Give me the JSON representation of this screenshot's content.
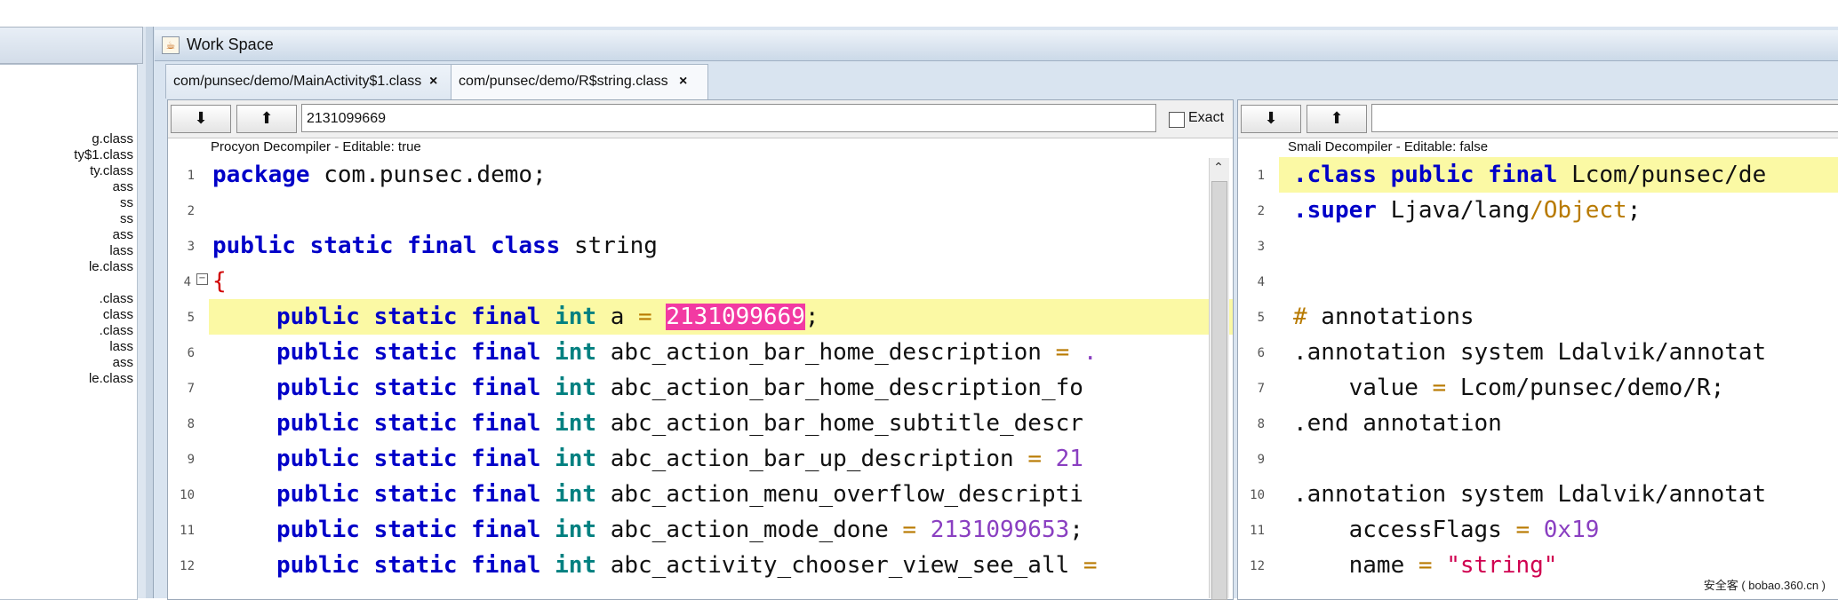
{
  "left_panel": {
    "tree_items": [
      "g.class",
      "ty$1.class",
      "ty.class",
      "ass",
      "ss",
      "ss",
      "ass",
      "lass",
      "le.class",
      "",
      ".class",
      "class",
      ".class",
      "lass",
      "ass",
      "le.class"
    ]
  },
  "workspace": {
    "title": "Work Space",
    "title_icon": "java-cup-icon"
  },
  "tabs": [
    {
      "label": "com/punsec/demo/MainActivity$1.class",
      "close": "×"
    },
    {
      "label": "com/punsec/demo/R$string.class",
      "close": "×"
    }
  ],
  "left_editor": {
    "download_button": "⬇",
    "upload_button": "⬆",
    "search_value": "2131099669",
    "exact_label": "Exact",
    "exact_checked": false,
    "decompiler_label": "Procyon Decompiler - Editable: true",
    "line_numbers": [
      "1",
      "2",
      "3",
      "4",
      "5",
      "6",
      "7",
      "8",
      "9",
      "10",
      "11",
      "12"
    ]
  },
  "right_editor": {
    "download_button": "⬇",
    "upload_button": "⬆",
    "search_value": "",
    "decompiler_label": "Smali Decompiler - Editable: false",
    "line_numbers": [
      "1",
      "2",
      "3",
      "4",
      "5",
      "6",
      "7",
      "8",
      "9",
      "10",
      "11",
      "12"
    ]
  },
  "code_left": {
    "l1_kw": "package",
    "l1_rest": " com.punsec.demo;",
    "l3_kw": "public static final class",
    "l3_rest": " string",
    "l4_brace": "{",
    "mods": "public static final",
    "type": "int",
    "eq": "=",
    "l5_name": " a ",
    "l5_value": "2131099669",
    "l5_end": ";",
    "l6_name": " abc_action_bar_home_description ",
    "l6_tail": ".",
    "l7_name": " abc_action_bar_home_description_fo",
    "l8_name": " abc_action_bar_home_subtitle_descr",
    "l9_name": " abc_action_bar_up_description ",
    "l9_tail": "21",
    "l10_name": " abc_action_menu_overflow_descripti",
    "l11_name": " abc_action_mode_done ",
    "l11_value": "2131099653",
    "l11_end": ";",
    "l12_name": " abc_activity_chooser_view_see_all ",
    "l12_tail": "="
  },
  "code_right": {
    "l1_dir": ".class public final",
    "l1_rest": " Lcom/punsec/de",
    "l2_dir": ".super",
    "l2_rest": " Ljava/lang",
    "l2_slash": "/",
    "l2_obj": "Object",
    "l2_end": ";",
    "l5_hash": "#",
    "l5_rest": " annotations",
    "l6": ".annotation system Ldalvik/annotat",
    "l7_key": "    value ",
    "l7_eq": "=",
    "l7_val": " Lcom/punsec/demo/R;",
    "l8": ".end annotation",
    "l10": ".annotation system Ldalvik/annotat",
    "l11_key": "    accessFlags ",
    "l11_eq": "=",
    "l11_val": "0x19",
    "l12_key": "    name ",
    "l12_eq": "=",
    "l12_val": "\"string\""
  },
  "scrollbar": {
    "up_arrow": "⌃"
  },
  "watermark": "安全客 ( bobao.360.cn )",
  "colors": {
    "keyword": "#0000c8",
    "type": "#008080",
    "number": "#8a3fc1",
    "highlight_line": "#fbf9a4",
    "search_match": "#f23aa2"
  }
}
